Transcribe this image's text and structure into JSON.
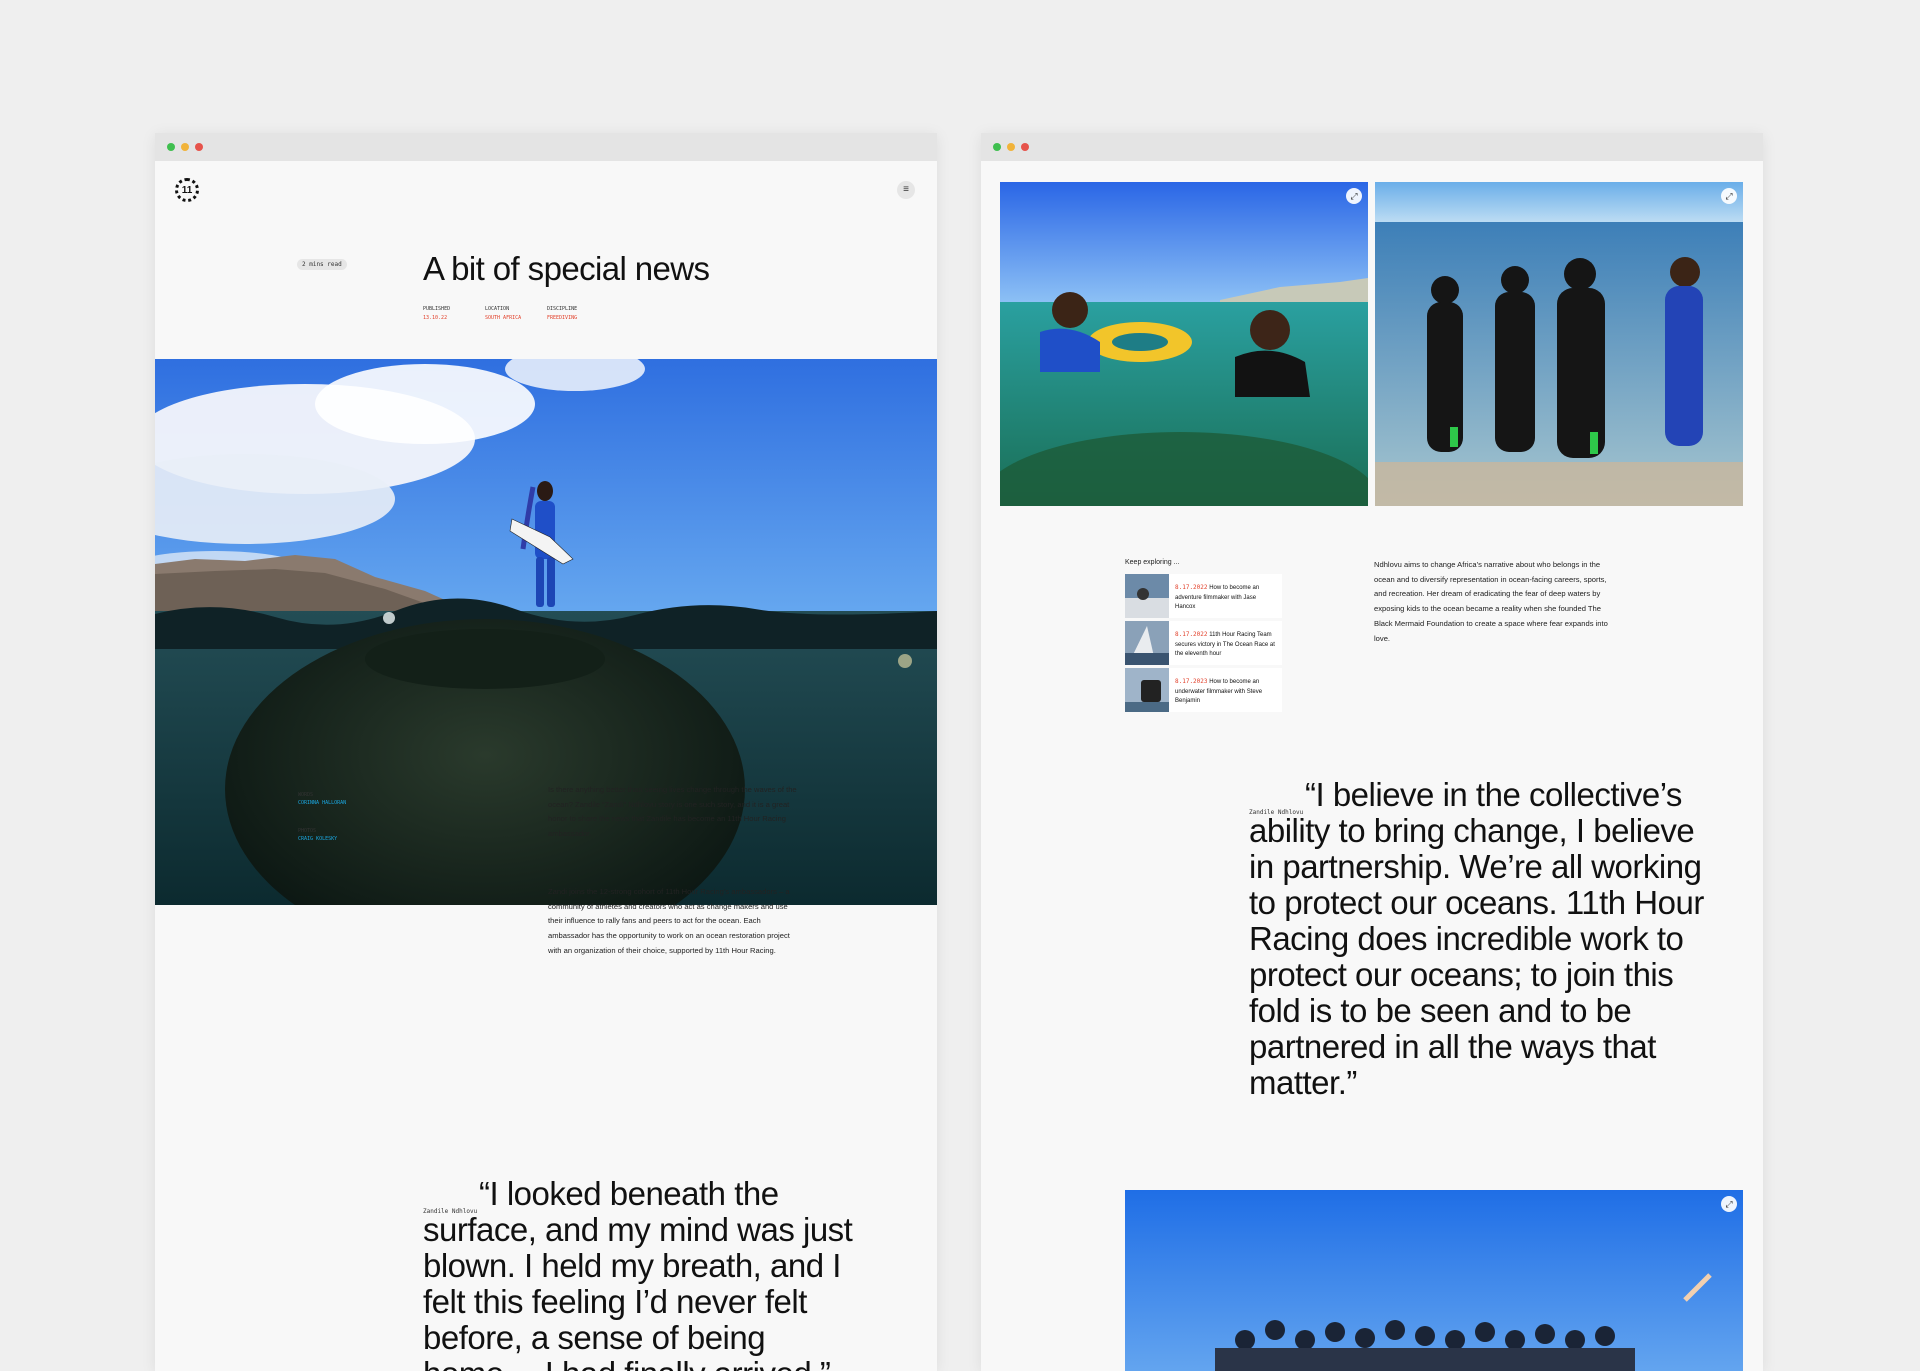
{
  "colors": {
    "background": "#efefef",
    "accent_red": "#e2402a",
    "accent_blue": "#1aa7e0",
    "dot_green": "#3fbf4f",
    "dot_yellow": "#f1b33a",
    "dot_red": "#e6534b"
  },
  "left": {
    "logo_text": "11",
    "menu_icon": "≡",
    "read_time": "2 mins read",
    "headline": "A bit of special news",
    "meta": [
      {
        "label": "PUBLISHED",
        "value": "13.10.22"
      },
      {
        "label": "LOCATION",
        "value": "SOUTH AFRICA"
      },
      {
        "label": "DISCIPLINE",
        "value": "FREEDIVING"
      }
    ],
    "credits": [
      {
        "label": "WORDS",
        "value": "CORINNA HALLORAN"
      },
      {
        "label": "PHOTOS",
        "value": "CRAIG KOLESKY"
      }
    ],
    "paragraphs": [
      "Is there anything better than seeing lives change through the waves of the ocean? Zandile “Zandi” Ndhlovu story is one such story, and it is a great honor to share the news that Zandile has become an 11th Hour Racing ambassador.",
      "Zandi joins the 12-strong cohort of 11th Hour Racing’s ambassadors – a community of athletes and creators who act as change makers and use their influence to rally fans and peers to act for the ocean. Each ambassador has the opportunity to work on an ocean restoration project with an organization of their choice, supported by 11th Hour Racing."
    ],
    "quote_attribution": "Zandile Ndhlovu",
    "quote": "“I looked beneath the surface, and my mind was just blown. I held my breath, and I felt this feeling I’d never felt before, a sense of being home… I had finally arrived.”"
  },
  "right": {
    "expand_icon": "⤢",
    "keep_exploring": "Keep exploring ...",
    "cards": [
      {
        "date": "8.17.2022",
        "title": "How to become an adventure filmmaker with Jase Hancox"
      },
      {
        "date": "8.17.2022",
        "title": "11th Hour Racing Team secures victory in The Ocean Race at the eleventh hour"
      },
      {
        "date": "8.17.2023",
        "title": "How to become an underwater filmmaker with Steve Benjamin"
      }
    ],
    "paragraph": "Ndhlovu aims to change Africa’s narrative about who belongs in the ocean and to diversify representation in ocean-facing careers, sports, and recreation. Her dream of eradicating the fear of deep waters by exposing kids to the ocean became a reality when she founded The Black Mermaid Foundation to create a space where fear expands into love.",
    "quote_attribution": "Zandile Ndhlovu",
    "quote": "“I believe in the collective’s ability to bring change, I believe in partnership. We’re all working to protect our oceans. 11th Hour Racing does incredible work to protect our oceans; to join this fold is to be seen and to be partnered in all the ways that matter.”"
  }
}
